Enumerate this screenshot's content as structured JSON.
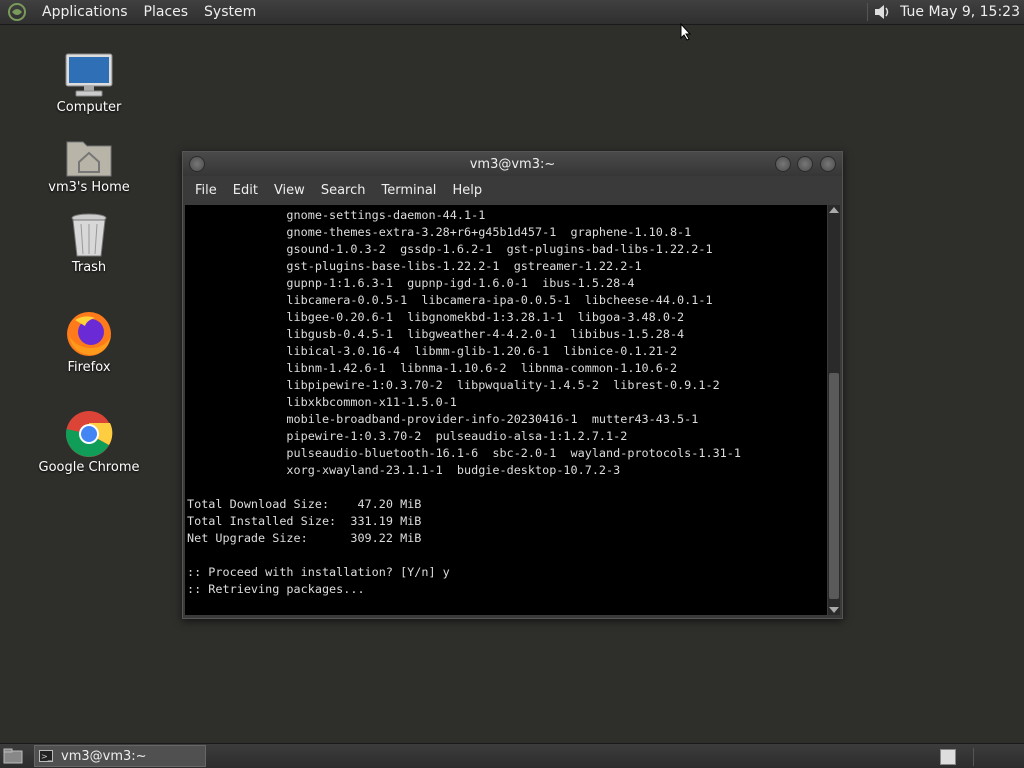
{
  "top_panel": {
    "menus": [
      "Applications",
      "Places",
      "System"
    ],
    "clock": "Tue May  9, 15:23"
  },
  "desktop_icons": [
    {
      "label": "Computer",
      "icon": "computer-icon"
    },
    {
      "label": "vm3's Home",
      "icon": "home-folder-icon"
    },
    {
      "label": "Trash",
      "icon": "trash-icon"
    },
    {
      "label": "Firefox",
      "icon": "firefox-icon"
    },
    {
      "label": "Google Chrome",
      "icon": "chrome-icon"
    }
  ],
  "window": {
    "title": "vm3@vm3:~",
    "menus": [
      "File",
      "Edit",
      "View",
      "Search",
      "Terminal",
      "Help"
    ]
  },
  "terminal_lines": [
    "              gnome-settings-daemon-44.1-1",
    "              gnome-themes-extra-3.28+r6+g45b1d457-1  graphene-1.10.8-1",
    "              gsound-1.0.3-2  gssdp-1.6.2-1  gst-plugins-bad-libs-1.22.2-1",
    "              gst-plugins-base-libs-1.22.2-1  gstreamer-1.22.2-1",
    "              gupnp-1:1.6.3-1  gupnp-igd-1.6.0-1  ibus-1.5.28-4",
    "              libcamera-0.0.5-1  libcamera-ipa-0.0.5-1  libcheese-44.0.1-1",
    "              libgee-0.20.6-1  libgnomekbd-1:3.28.1-1  libgoa-3.48.0-2",
    "              libgusb-0.4.5-1  libgweather-4-4.2.0-1  libibus-1.5.28-4",
    "              libical-3.0.16-4  libmm-glib-1.20.6-1  libnice-0.1.21-2",
    "              libnm-1.42.6-1  libnma-1.10.6-2  libnma-common-1.10.6-2",
    "              libpipewire-1:0.3.70-2  libpwquality-1.4.5-2  librest-0.9.1-2",
    "              libxkbcommon-x11-1.5.0-1",
    "              mobile-broadband-provider-info-20230416-1  mutter43-43.5-1",
    "              pipewire-1:0.3.70-2  pulseaudio-alsa-1:1.2.7.1-2",
    "              pulseaudio-bluetooth-16.1-6  sbc-2.0-1  wayland-protocols-1.31-1",
    "              xorg-xwayland-23.1.1-1  budgie-desktop-10.7.2-3",
    "",
    "Total Download Size:    47.20 MiB",
    "Total Installed Size:  331.19 MiB",
    "Net Upgrade Size:      309.22 MiB",
    "",
    ":: Proceed with installation? [Y/n] y",
    ":: Retrieving packages..."
  ],
  "taskbar": {
    "task_label": "vm3@vm3:~"
  }
}
